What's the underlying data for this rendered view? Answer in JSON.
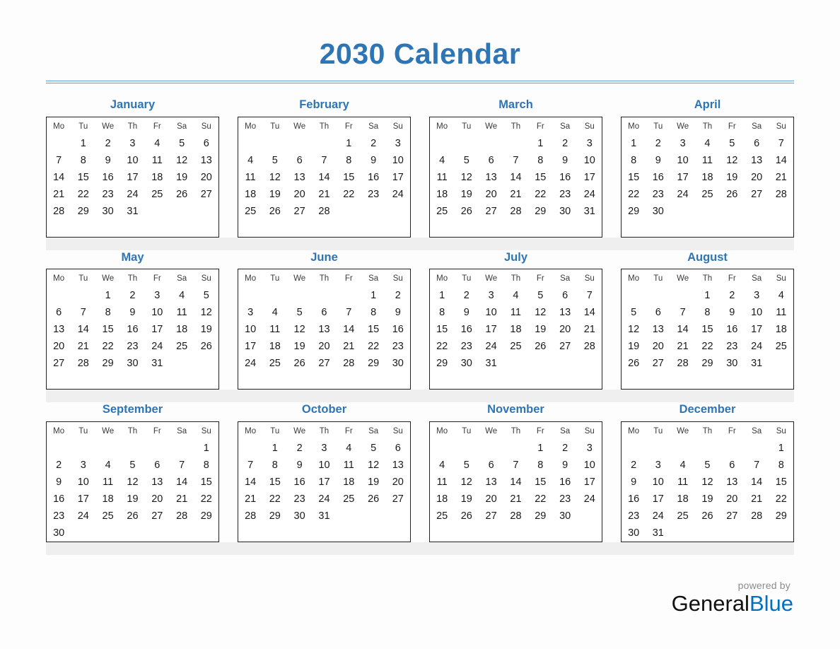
{
  "title": "2030 Calendar",
  "weekdays": [
    "Mo",
    "Tu",
    "We",
    "Th",
    "Fr",
    "Sa",
    "Su"
  ],
  "colors": {
    "title_blue": "#2E75B6",
    "rule_blue": "#5B9BD5",
    "month_blue": "#2E75B6",
    "brand_blue": "#0070C0",
    "band_gray": "#EFEFEF",
    "page_background": "#FDFDFD"
  },
  "footer": {
    "powered_by": "powered by",
    "brand_first": "General",
    "brand_second": "Blue"
  },
  "months": [
    {
      "name": "January",
      "start_weekday_index": 1,
      "days_in_month": 31,
      "weeks": [
        [
          "",
          "1",
          "2",
          "3",
          "4",
          "5",
          "6"
        ],
        [
          "7",
          "8",
          "9",
          "10",
          "11",
          "12",
          "13"
        ],
        [
          "14",
          "15",
          "16",
          "17",
          "18",
          "19",
          "20"
        ],
        [
          "21",
          "22",
          "23",
          "24",
          "25",
          "26",
          "27"
        ],
        [
          "28",
          "29",
          "30",
          "31",
          "",
          "",
          ""
        ],
        [
          "",
          "",
          "",
          "",
          "",
          "",
          ""
        ]
      ]
    },
    {
      "name": "February",
      "start_weekday_index": 4,
      "days_in_month": 28,
      "weeks": [
        [
          "",
          "",
          "",
          "",
          "1",
          "2",
          "3"
        ],
        [
          "4",
          "5",
          "6",
          "7",
          "8",
          "9",
          "10"
        ],
        [
          "11",
          "12",
          "13",
          "14",
          "15",
          "16",
          "17"
        ],
        [
          "18",
          "19",
          "20",
          "21",
          "22",
          "23",
          "24"
        ],
        [
          "25",
          "26",
          "27",
          "28",
          "",
          "",
          ""
        ],
        [
          "",
          "",
          "",
          "",
          "",
          "",
          ""
        ]
      ]
    },
    {
      "name": "March",
      "start_weekday_index": 4,
      "days_in_month": 31,
      "weeks": [
        [
          "",
          "",
          "",
          "",
          "1",
          "2",
          "3"
        ],
        [
          "4",
          "5",
          "6",
          "7",
          "8",
          "9",
          "10"
        ],
        [
          "11",
          "12",
          "13",
          "14",
          "15",
          "16",
          "17"
        ],
        [
          "18",
          "19",
          "20",
          "21",
          "22",
          "23",
          "24"
        ],
        [
          "25",
          "26",
          "27",
          "28",
          "29",
          "30",
          "31"
        ],
        [
          "",
          "",
          "",
          "",
          "",
          "",
          ""
        ]
      ]
    },
    {
      "name": "April",
      "start_weekday_index": 0,
      "days_in_month": 30,
      "weeks": [
        [
          "1",
          "2",
          "3",
          "4",
          "5",
          "6",
          "7"
        ],
        [
          "8",
          "9",
          "10",
          "11",
          "12",
          "13",
          "14"
        ],
        [
          "15",
          "16",
          "17",
          "18",
          "19",
          "20",
          "21"
        ],
        [
          "22",
          "23",
          "24",
          "25",
          "26",
          "27",
          "28"
        ],
        [
          "29",
          "30",
          "",
          "",
          "",
          "",
          ""
        ],
        [
          "",
          "",
          "",
          "",
          "",
          "",
          ""
        ]
      ]
    },
    {
      "name": "May",
      "start_weekday_index": 2,
      "days_in_month": 31,
      "weeks": [
        [
          "",
          "",
          "1",
          "2",
          "3",
          "4",
          "5"
        ],
        [
          "6",
          "7",
          "8",
          "9",
          "10",
          "11",
          "12"
        ],
        [
          "13",
          "14",
          "15",
          "16",
          "17",
          "18",
          "19"
        ],
        [
          "20",
          "21",
          "22",
          "23",
          "24",
          "25",
          "26"
        ],
        [
          "27",
          "28",
          "29",
          "30",
          "31",
          "",
          ""
        ],
        [
          "",
          "",
          "",
          "",
          "",
          "",
          ""
        ]
      ]
    },
    {
      "name": "June",
      "start_weekday_index": 5,
      "days_in_month": 30,
      "weeks": [
        [
          "",
          "",
          "",
          "",
          "",
          "1",
          "2"
        ],
        [
          "3",
          "4",
          "5",
          "6",
          "7",
          "8",
          "9"
        ],
        [
          "10",
          "11",
          "12",
          "13",
          "14",
          "15",
          "16"
        ],
        [
          "17",
          "18",
          "19",
          "20",
          "21",
          "22",
          "23"
        ],
        [
          "24",
          "25",
          "26",
          "27",
          "28",
          "29",
          "30"
        ],
        [
          "",
          "",
          "",
          "",
          "",
          "",
          ""
        ]
      ]
    },
    {
      "name": "July",
      "start_weekday_index": 0,
      "days_in_month": 31,
      "weeks": [
        [
          "1",
          "2",
          "3",
          "4",
          "5",
          "6",
          "7"
        ],
        [
          "8",
          "9",
          "10",
          "11",
          "12",
          "13",
          "14"
        ],
        [
          "15",
          "16",
          "17",
          "18",
          "19",
          "20",
          "21"
        ],
        [
          "22",
          "23",
          "24",
          "25",
          "26",
          "27",
          "28"
        ],
        [
          "29",
          "30",
          "31",
          "",
          "",
          "",
          ""
        ],
        [
          "",
          "",
          "",
          "",
          "",
          "",
          ""
        ]
      ]
    },
    {
      "name": "August",
      "start_weekday_index": 3,
      "days_in_month": 31,
      "weeks": [
        [
          "",
          "",
          "",
          "1",
          "2",
          "3",
          "4"
        ],
        [
          "5",
          "6",
          "7",
          "8",
          "9",
          "10",
          "11"
        ],
        [
          "12",
          "13",
          "14",
          "15",
          "16",
          "17",
          "18"
        ],
        [
          "19",
          "20",
          "21",
          "22",
          "23",
          "24",
          "25"
        ],
        [
          "26",
          "27",
          "28",
          "29",
          "30",
          "31",
          ""
        ],
        [
          "",
          "",
          "",
          "",
          "",
          "",
          ""
        ]
      ]
    },
    {
      "name": "September",
      "start_weekday_index": 6,
      "days_in_month": 30,
      "weeks": [
        [
          "",
          "",
          "",
          "",
          "",
          "",
          "1"
        ],
        [
          "2",
          "3",
          "4",
          "5",
          "6",
          "7",
          "8"
        ],
        [
          "9",
          "10",
          "11",
          "12",
          "13",
          "14",
          "15"
        ],
        [
          "16",
          "17",
          "18",
          "19",
          "20",
          "21",
          "22"
        ],
        [
          "23",
          "24",
          "25",
          "26",
          "27",
          "28",
          "29"
        ],
        [
          "30",
          "",
          "",
          "",
          "",
          "",
          ""
        ]
      ]
    },
    {
      "name": "October",
      "start_weekday_index": 1,
      "days_in_month": 31,
      "weeks": [
        [
          "",
          "1",
          "2",
          "3",
          "4",
          "5",
          "6"
        ],
        [
          "7",
          "8",
          "9",
          "10",
          "11",
          "12",
          "13"
        ],
        [
          "14",
          "15",
          "16",
          "17",
          "18",
          "19",
          "20"
        ],
        [
          "21",
          "22",
          "23",
          "24",
          "25",
          "26",
          "27"
        ],
        [
          "28",
          "29",
          "30",
          "31",
          "",
          "",
          ""
        ],
        [
          "",
          "",
          "",
          "",
          "",
          "",
          ""
        ]
      ]
    },
    {
      "name": "November",
      "start_weekday_index": 4,
      "days_in_month": 30,
      "weeks": [
        [
          "",
          "",
          "",
          "",
          "1",
          "2",
          "3"
        ],
        [
          "4",
          "5",
          "6",
          "7",
          "8",
          "9",
          "10"
        ],
        [
          "11",
          "12",
          "13",
          "14",
          "15",
          "16",
          "17"
        ],
        [
          "18",
          "19",
          "20",
          "21",
          "22",
          "23",
          "24"
        ],
        [
          "25",
          "26",
          "27",
          "28",
          "29",
          "30",
          ""
        ],
        [
          "",
          "",
          "",
          "",
          "",
          "",
          ""
        ]
      ]
    },
    {
      "name": "December",
      "start_weekday_index": 6,
      "days_in_month": 31,
      "weeks": [
        [
          "",
          "",
          "",
          "",
          "",
          "",
          "1"
        ],
        [
          "2",
          "3",
          "4",
          "5",
          "6",
          "7",
          "8"
        ],
        [
          "9",
          "10",
          "11",
          "12",
          "13",
          "14",
          "15"
        ],
        [
          "16",
          "17",
          "18",
          "19",
          "20",
          "21",
          "22"
        ],
        [
          "23",
          "24",
          "25",
          "26",
          "27",
          "28",
          "29"
        ],
        [
          "30",
          "31",
          "",
          "",
          "",
          "",
          ""
        ]
      ]
    }
  ]
}
